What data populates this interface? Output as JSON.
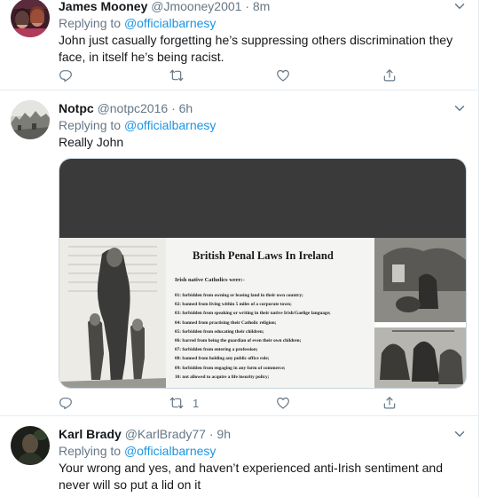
{
  "tweets": [
    {
      "name": "James Mooney",
      "handle": "@Jmooney2001",
      "separator": "·",
      "time": "8m",
      "replying_to_prefix": "Replying to",
      "replying_to_handle": "@officialbarnesy",
      "text": "John just casually forgetting he’s suppressing others discrimination they face, in itself he’s being racist.",
      "retweet_count": "",
      "avatar_icon": "profile-photo"
    },
    {
      "name": "Notpc",
      "handle": "@notpc2016",
      "separator": "·",
      "time": "6h",
      "replying_to_prefix": "Replying to",
      "replying_to_handle": "@officialbarnesy",
      "text": "Really John",
      "retweet_count": "1",
      "avatar_icon": "profile-photo",
      "media": {
        "title": "British Penal Laws In Ireland",
        "subtitle": "Irish native Catholics were:-",
        "items": [
          "01: forbidden from owning or leasing land in their own country;",
          "02: banned from living within 5 miles of a corporate town;",
          "03: forbidden from speaking or writing in their native Irish/Gaelige language;",
          "04: banned from practising their Catholic religion;",
          "05: forbidden from educating their children;",
          "06: barred from being the guardian of even their own children;",
          "07: forbidden from entering a profession;",
          "08: banned from holding any public office role;",
          "09: forbidden from engaging in any form of commerce;",
          "10: not allowed to acquire a life insurity policy;"
        ]
      }
    },
    {
      "name": "Karl Brady",
      "handle": "@KarlBrady77",
      "separator": "·",
      "time": "9h",
      "replying_to_prefix": "Replying to",
      "replying_to_handle": "@officialbarnesy",
      "text": "Your wrong and yes, and haven’t experienced anti-Irish sentiment and never will so put a lid on it",
      "avatar_icon": "profile-photo"
    }
  ],
  "colors": {
    "accent": "#1b95e0",
    "secondary_text": "#657786",
    "primary_text": "#14171a",
    "border": "#e6ecf0"
  },
  "icons": [
    "reply-icon",
    "retweet-icon",
    "like-icon",
    "share-icon",
    "chevron-down-icon"
  ]
}
